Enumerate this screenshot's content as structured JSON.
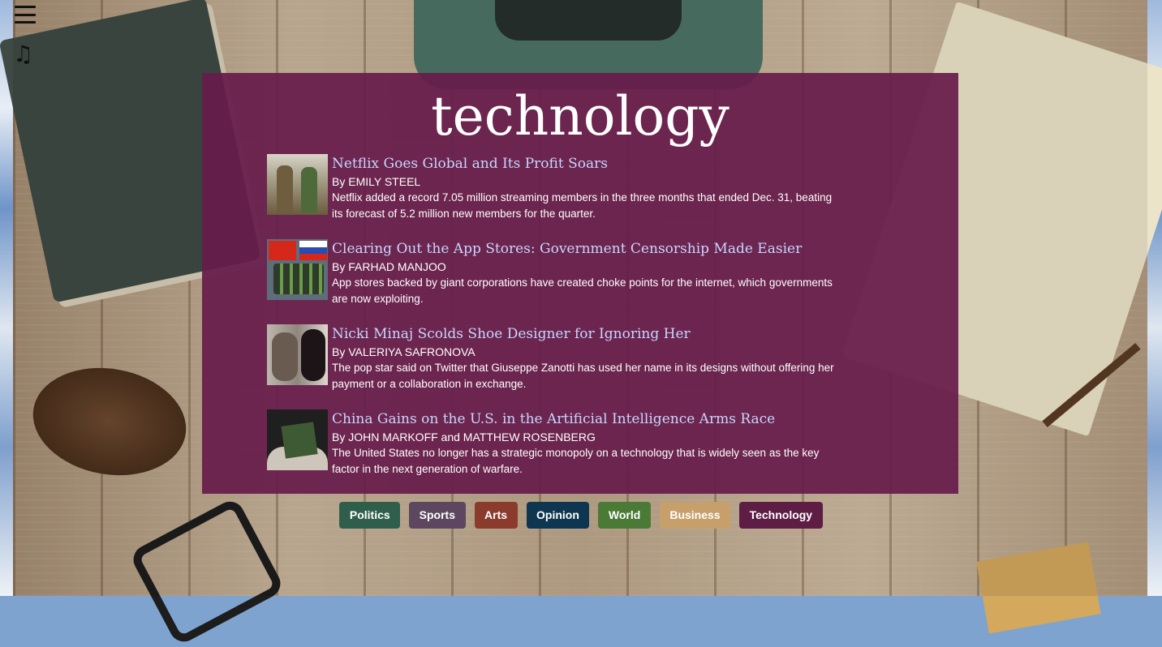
{
  "page": {
    "title": "technology"
  },
  "icons": {
    "menu": "hamburger-menu-icon",
    "music": "music-note-icon",
    "music_glyph": "♫"
  },
  "articles": [
    {
      "headline": "Netflix Goes Global and Its Profit Soars",
      "byline": "By EMILY STEEL",
      "summary": "Netflix added a record 7.05 million streaming members in the three months that ended Dec. 31, beating its forecast of 5.2 million new members for the quarter."
    },
    {
      "headline": "Clearing Out the App Stores: Government Censorship Made Easier",
      "byline": "By FARHAD MANJOO",
      "summary": "App stores backed by giant corporations have created choke points for the internet, which governments are now exploiting."
    },
    {
      "headline": "Nicki Minaj Scolds Shoe Designer for Ignoring Her",
      "byline": "By VALERIYA SAFRONOVA",
      "summary": "The pop star said on Twitter that Giuseppe Zanotti has used her name in its designs without offering her payment or a collaboration in exchange."
    },
    {
      "headline": "China Gains on the U.S. in the Artificial Intelligence Arms Race",
      "byline": "By JOHN MARKOFF and MATTHEW ROSENBERG",
      "summary": "The United States no longer has a strategic monopoly on a technology that is widely seen as the key factor in the next generation of warfare."
    }
  ],
  "nav": [
    {
      "label": "Politics",
      "color": "#2f5f4c"
    },
    {
      "label": "Sports",
      "color": "#5d4760"
    },
    {
      "label": "Arts",
      "color": "#8a3b2c"
    },
    {
      "label": "Opinion",
      "color": "#0f3650"
    },
    {
      "label": "World",
      "color": "#4a7a35"
    },
    {
      "label": "Business",
      "color": "#c69f6a"
    },
    {
      "label": "Technology",
      "color": "#5e1d45"
    }
  ],
  "colors": {
    "panel": "#661c4a",
    "headline": "#c8d6ff"
  }
}
